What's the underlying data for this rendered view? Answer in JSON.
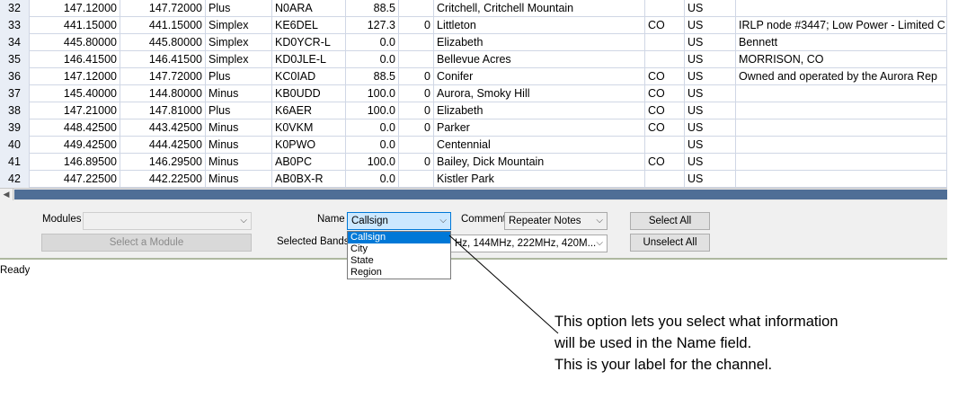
{
  "table": {
    "rows": [
      {
        "idx": "32",
        "rx": "147.12000",
        "tx": "147.72000",
        "shift": "Plus",
        "call": "N0ARA",
        "tone": "88.5",
        "z": "",
        "loc": "Critchell, Critchell Mountain",
        "st": "",
        "ctry": "US",
        "notes": ""
      },
      {
        "idx": "33",
        "rx": "441.15000",
        "tx": "441.15000",
        "shift": "Simplex",
        "call": "KE6DEL",
        "tone": "127.3",
        "z": "0",
        "loc": "Littleton",
        "st": "CO",
        "ctry": "US",
        "notes": "IRLP node #3447; Low Power - Limited C"
      },
      {
        "idx": "34",
        "rx": "445.80000",
        "tx": "445.80000",
        "shift": "Simplex",
        "call": "KD0YCR-L",
        "tone": "0.0",
        "z": "",
        "loc": "Elizabeth",
        "st": "",
        "ctry": "US",
        "notes": " Bennett"
      },
      {
        "idx": "35",
        "rx": "146.41500",
        "tx": "146.41500",
        "shift": "Simplex",
        "call": "KD0JLE-L",
        "tone": "0.0",
        "z": "",
        "loc": "Bellevue Acres",
        "st": "",
        "ctry": "US",
        "notes": " MORRISON, CO"
      },
      {
        "idx": "36",
        "rx": "147.12000",
        "tx": "147.72000",
        "shift": "Plus",
        "call": "KC0IAD",
        "tone": "88.5",
        "z": "0",
        "loc": "Conifer",
        "st": "CO",
        "ctry": "US",
        "notes": "Owned and operated by the Aurora Rep"
      },
      {
        "idx": "37",
        "rx": "145.40000",
        "tx": "144.80000",
        "shift": "Minus",
        "call": "KB0UDD",
        "tone": "100.0",
        "z": "0",
        "loc": "Aurora, Smoky Hill",
        "st": "CO",
        "ctry": "US",
        "notes": ""
      },
      {
        "idx": "38",
        "rx": "147.21000",
        "tx": "147.81000",
        "shift": "Plus",
        "call": "K6AER",
        "tone": "100.0",
        "z": "0",
        "loc": "Elizabeth",
        "st": "CO",
        "ctry": "US",
        "notes": ""
      },
      {
        "idx": "39",
        "rx": "448.42500",
        "tx": "443.42500",
        "shift": "Minus",
        "call": "K0VKM",
        "tone": "0.0",
        "z": "0",
        "loc": "Parker",
        "st": "CO",
        "ctry": "US",
        "notes": ""
      },
      {
        "idx": "40",
        "rx": "449.42500",
        "tx": "444.42500",
        "shift": "Minus",
        "call": "K0PWO",
        "tone": "0.0",
        "z": "",
        "loc": "Centennial",
        "st": "",
        "ctry": "US",
        "notes": ""
      },
      {
        "idx": "41",
        "rx": "146.89500",
        "tx": "146.29500",
        "shift": "Minus",
        "call": "AB0PC",
        "tone": "100.0",
        "z": "0",
        "loc": "Bailey, Dick Mountain",
        "st": "CO",
        "ctry": "US",
        "notes": ""
      },
      {
        "idx": "42",
        "rx": "447.22500",
        "tx": "442.22500",
        "shift": "Minus",
        "call": "AB0BX-R",
        "tone": "0.0",
        "z": "",
        "loc": "Kistler Park",
        "st": "",
        "ctry": "US",
        "notes": ""
      }
    ]
  },
  "scroll": {
    "left_arrow": "◀"
  },
  "controls": {
    "modules_label": "Modules",
    "modules_value": "",
    "select_module_button": "Select a Module",
    "name_label": "Name",
    "name_value": "Callsign",
    "comment_label": "Comment",
    "comment_value": "Repeater Notes",
    "select_all_button": "Select All",
    "selected_bands_label": "Selected Bands",
    "selected_bands_value": "Hz, 144MHz, 222MHz, 420M...",
    "unselect_all_button": "Unselect All",
    "chevron": "⌵"
  },
  "name_dropdown": {
    "options": [
      "Callsign",
      "City",
      "State",
      "Region"
    ],
    "selected": "Callsign"
  },
  "status": {
    "text": "Ready"
  },
  "annotation": {
    "lines": [
      "This option lets you select what information",
      "will be used in the Name field.",
      "This is your label for the channel."
    ]
  }
}
